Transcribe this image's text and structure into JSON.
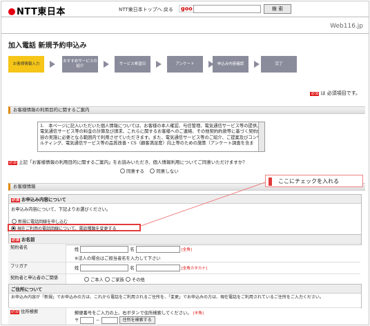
{
  "header": {
    "logo": "NTT東日本",
    "top_link": "NTT東日本トップへ 戻る",
    "search_brand": "goo",
    "search_button": "検 索",
    "site_name": "Web116.jp"
  },
  "page_title": "加入電話 新規予約申込み",
  "steps": [
    {
      "label": "お客様情報入力",
      "active": true
    },
    {
      "label": "おすすめサービスの紹介",
      "active": false
    },
    {
      "label": "サービス希望日",
      "active": false
    },
    {
      "label": "アンケート",
      "active": false
    },
    {
      "label": "申込み内容確認",
      "active": false
    },
    {
      "label": "完了",
      "active": false
    }
  ],
  "required_badge": "必須",
  "required_note": "は 必須項目です。",
  "privacy": {
    "section_title": "お客様情報の利用目的に関するご案内",
    "text": "1.　本ページに記入いただいた個人情報については、お客様の本人確認、与信管理、電気通信サービス等の提供、電気通信サービス等の料金の計算及び請求、これらに関するお客様へのご連絡、その他契約約款等に基づく契約内容の実施に必要となる範囲内で利用させていただきます。また、電気通信サービス等のご紹介、ご提案及びコンサルティング、電気通信サービス等の品質改善・CS（顧客満足度）向上等のための施策（アンケート調査を含ま",
    "agree_question": "上記「お客様情報の利用目的に関するご案内」をお読みいただき、個人情報利用についてご同意いただけますか？",
    "agree_yes": "同意する",
    "agree_no": "同意しない"
  },
  "callout": "ここにチェックを入れる",
  "customer": {
    "section_title": "お客様情報",
    "contents_title": "お申込み内容について",
    "contents_prompt": "お申込み内容について、下記よりお選びください。",
    "option_new": "新規に電話回線を申し込む",
    "option_change": "現在ご利用の電話回線について、電話種類を変更する",
    "name_title": "お名前",
    "name_label": "契約者名",
    "kana_label": "フリガナ",
    "surname": "姓",
    "given": "名",
    "name_note": "[全角]",
    "kana_note": "[全角カタカナ]",
    "corp_note": "※法人の場合はご担当者名を入力して下さい",
    "relation_label": "契約者と申込者のご関係",
    "relation_options": [
      "ご本人",
      "ご家族",
      "その他"
    ],
    "address_title": "ご住所について",
    "address_text": "お申込み内容が「新規」でお申込みの方は、これから電話をご利用されるご住所を、「変更」でお申込みの方は、現在電話をご利用されているご住所をご入力ください。",
    "address_label": "住所検索",
    "address_hint": "郵便番号をご入力の上、右ボタンで住所検索してください。",
    "address_hint_note": "[半角]",
    "postal_label": "〒",
    "postal_sep": "－",
    "address_button": "住所を検索する"
  }
}
